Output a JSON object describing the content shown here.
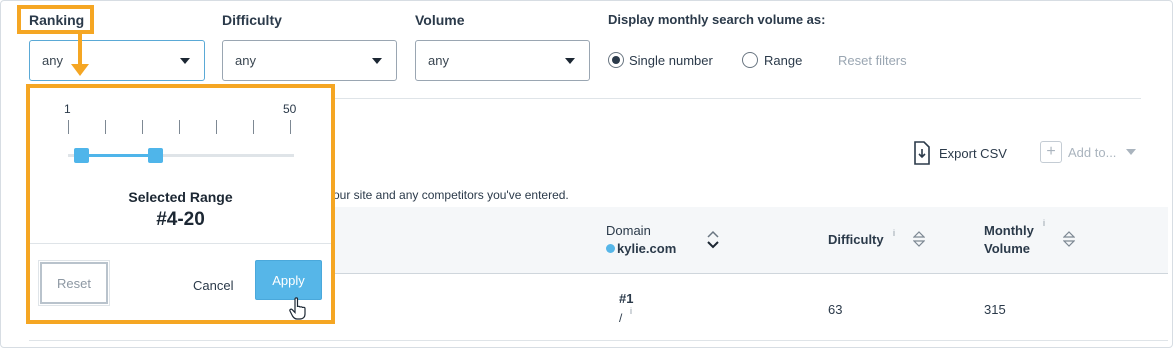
{
  "filters": {
    "ranking": {
      "label": "Ranking",
      "value": "any"
    },
    "difficulty": {
      "label": "Difficulty",
      "value": "any"
    },
    "volume": {
      "label": "Volume",
      "value": "any"
    }
  },
  "display_volume": {
    "label": "Display monthly search volume as:",
    "options": [
      "Single number",
      "Range"
    ],
    "selected": "Single number",
    "reset_label": "Reset filters"
  },
  "toolbar": {
    "export_label": "Export CSV",
    "add_to_label": "Add to..."
  },
  "description_fragment": "our site and any competitors you've entered.",
  "table": {
    "domain_header": "Domain",
    "domain_name": "kylie.com",
    "difficulty_header": "Difficulty",
    "monthly_volume_header_line1": "Monthly",
    "monthly_volume_header_line2": "Volume",
    "info_mark": "i",
    "rows": [
      {
        "rank": "#1",
        "rank_sub": "/",
        "difficulty": "63",
        "volume": "315"
      }
    ]
  },
  "popup": {
    "min_label": "1",
    "max_label": "50",
    "range_min": 1,
    "range_max": 50,
    "selected_low": 4,
    "selected_high": 20,
    "selected_title": "Selected Range",
    "selected_value": "#4-20",
    "reset_label": "Reset",
    "cancel_label": "Cancel",
    "apply_label": "Apply"
  },
  "colors": {
    "highlight": "#f5a623",
    "accent": "#56b6e8"
  }
}
